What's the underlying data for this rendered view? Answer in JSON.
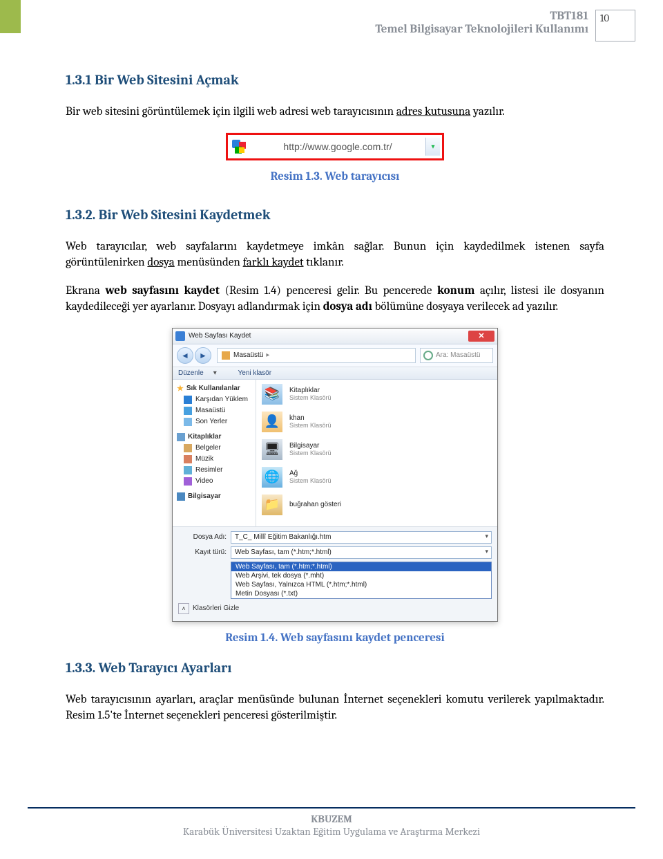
{
  "header": {
    "course_code": "TBT181",
    "course_title": "Temel Bilgisayar Teknolojileri Kullanımı",
    "page_number": "10"
  },
  "section_1_3_1": {
    "title": "1.3.1 Bir Web Sitesini Açmak",
    "para_prefix": "Bir web sitesini görüntülemek için ilgili web adresi web tarayıcısının ",
    "para_underline": "adres kutusuna",
    "para_suffix": " yazılır."
  },
  "figure_1_3": {
    "address_value": "http://www.google.com.tr/",
    "caption": "Resim 1.3. Web tarayıcısı"
  },
  "section_1_3_2": {
    "title": "1.3.2. Bir Web Sitesini Kaydetmek",
    "p1_a": "Web tarayıcılar, web sayfalarını kaydetmeye imkân sağlar. Bunun için kaydedilmek istenen sayfa görüntülenirken ",
    "p1_u1": "dosya",
    "p1_b": " menüsünden ",
    "p1_u2": "farklı kaydet",
    "p1_c": " tıklanır.",
    "p2_a": "Ekrana ",
    "p2_bold1": "web sayfasını kaydet",
    "p2_b": " (Resim 1.4) penceresi gelir. Bu pencerede ",
    "p2_bold2": "konum",
    "p2_c": " açılır, listesi ile dosyanın kaydedileceği yer ayarlanır. Dosyayı adlandırmak için ",
    "p2_bold3": "dosya adı",
    "p2_d": " bölümüne dosyaya verilecek ad yazılır."
  },
  "figure_1_4": {
    "dialog_title": "Web Sayfası Kaydet",
    "breadcrumb": "Masaüstü",
    "search_placeholder": "Ara: Masaüstü",
    "toolbar_menu1": "Düzenle",
    "toolbar_menu2": "Yeni klasör",
    "sidebar": {
      "fav_head": "Sık Kullanılanlar",
      "items_fav": [
        "Karşıdan Yüklem",
        "Masaüstü",
        "Son Yerler"
      ],
      "lib_head": "Kitaplıklar",
      "items_lib": [
        "Belgeler",
        "Müzik",
        "Resimler",
        "Video"
      ],
      "computer": "Bilgisayar",
      "hide_folders": "Klasörleri Gizle"
    },
    "files": [
      {
        "name": "Kitaplıklar",
        "sub": "Sistem Klasörü"
      },
      {
        "name": "khan",
        "sub": "Sistem Klasörü"
      },
      {
        "name": "Bilgisayar",
        "sub": "Sistem Klasörü"
      },
      {
        "name": "Ağ",
        "sub": "Sistem Klasörü"
      },
      {
        "name": "buğrahan gösteri",
        "sub": ""
      }
    ],
    "dosya_adi_label": "Dosya Adı:",
    "dosya_adi_value": "T_C_ Millî Eğitim Bakanlığı.htm",
    "kayit_turu_label": "Kayıt türü:",
    "kayit_turu_value": "Web Sayfası, tam (*.htm;*.html)",
    "dropdown_options": [
      "Web Sayfası, tam (*.htm;*.html)",
      "Web Arşivi, tek dosya (*.mht)",
      "Web Sayfası, Yalnızca HTML (*.htm;*.html)",
      "Metin Dosyası (*.txt)"
    ],
    "caption": "Resim 1.4. Web sayfasını kaydet penceresi"
  },
  "section_1_3_3": {
    "title": "1.3.3. Web Tarayıcı Ayarları",
    "para": "Web tarayıcısının ayarları, araçlar menüsünde bulunan İnternet seçenekleri komutu verilerek yapılmaktadır. Resim 1.5'te İnternet seçenekleri penceresi gösterilmiştir."
  },
  "footer": {
    "line1": "KBUZEM",
    "line2": "Karabük Üniversitesi Uzaktan Eğitim Uygulama ve Araştırma Merkezi"
  }
}
